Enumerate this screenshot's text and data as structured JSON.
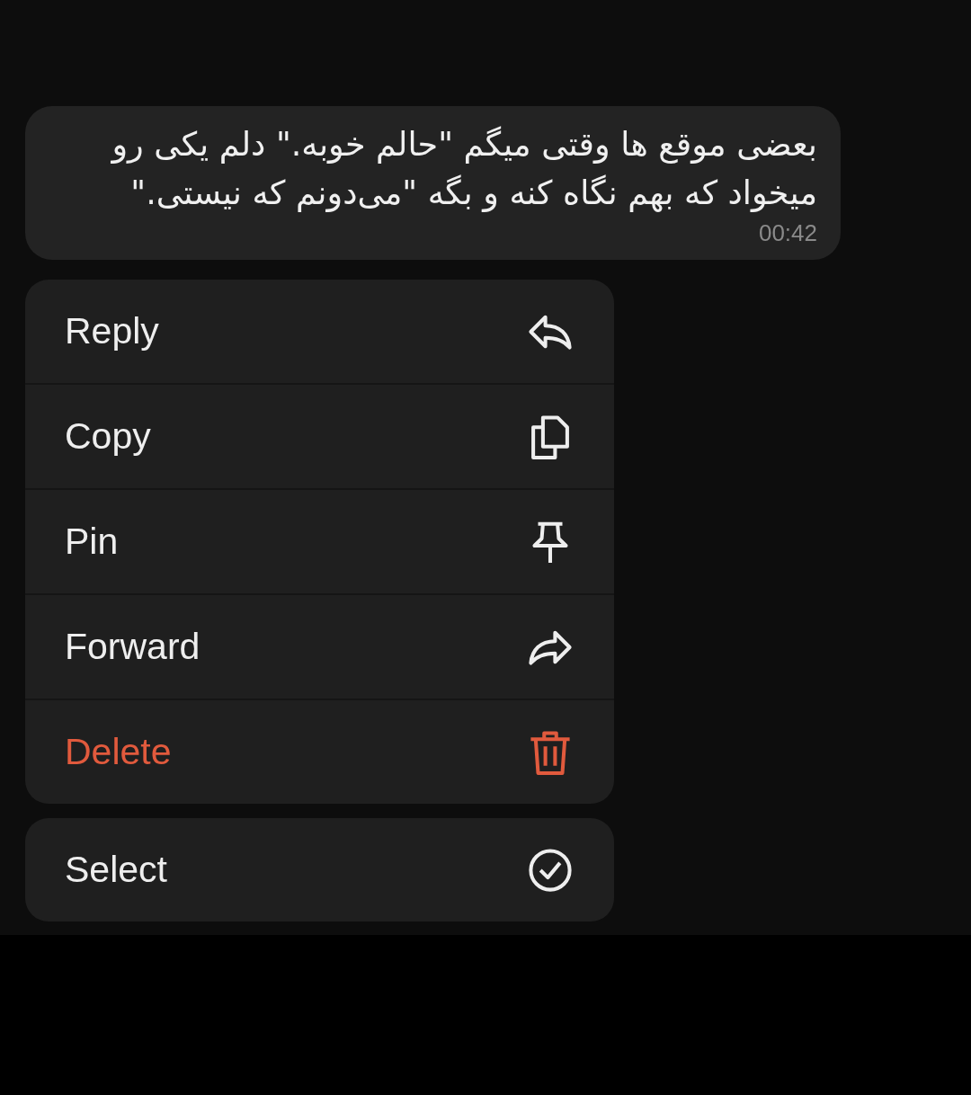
{
  "message": {
    "text": "بعضی موقع ها وقتی میگم \"حالم خوبه.\" دلم یکی رو میخواد که بهم نگاه کنه و بگه \"می‌دونم که نیستی.\"",
    "time": "00:42"
  },
  "menu": {
    "sections": [
      {
        "items": [
          {
            "label": "Reply",
            "kind": "reply",
            "destructive": false
          },
          {
            "label": "Copy",
            "kind": "copy",
            "destructive": false
          },
          {
            "label": "Pin",
            "kind": "pin",
            "destructive": false
          },
          {
            "label": "Forward",
            "kind": "forward",
            "destructive": false
          },
          {
            "label": "Delete",
            "kind": "delete",
            "destructive": true
          }
        ]
      },
      {
        "items": [
          {
            "label": "Select",
            "kind": "select",
            "destructive": false
          }
        ]
      }
    ]
  }
}
